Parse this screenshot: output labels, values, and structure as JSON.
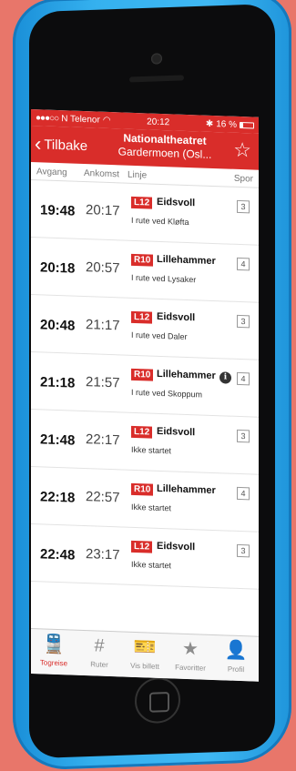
{
  "status": {
    "carrier": "N Telenor",
    "time": "20:12",
    "battery": "16 %"
  },
  "nav": {
    "back_label": "Tilbake",
    "title_line1": "Nationaltheatret",
    "title_line2": "Gardermoen (Osl..."
  },
  "columns": {
    "departure": "Avgang",
    "arrival": "Ankomst",
    "line": "Linje",
    "track": "Spor"
  },
  "rows": [
    {
      "dep": "19:48",
      "arr": "20:17",
      "line": "L12",
      "dest": "Eidsvoll",
      "note": "I rute ved Kløfta",
      "track": "3"
    },
    {
      "dep": "20:18",
      "arr": "20:57",
      "line": "R10",
      "dest": "Lillehammer",
      "note": "I rute ved Lysaker",
      "track": "4"
    },
    {
      "dep": "20:48",
      "arr": "21:17",
      "line": "L12",
      "dest": "Eidsvoll",
      "note": "I rute ved Daler",
      "track": "3"
    },
    {
      "dep": "21:18",
      "arr": "21:57",
      "line": "R10",
      "dest": "Lillehammer",
      "note": "I rute ved Skoppum",
      "track": "4",
      "info": "i"
    },
    {
      "dep": "21:48",
      "arr": "22:17",
      "line": "L12",
      "dest": "Eidsvoll",
      "note": "Ikke startet",
      "track": "3"
    },
    {
      "dep": "22:18",
      "arr": "22:57",
      "line": "R10",
      "dest": "Lillehammer",
      "note": "Ikke startet",
      "track": "4"
    },
    {
      "dep": "22:48",
      "arr": "23:17",
      "line": "L12",
      "dest": "Eidsvoll",
      "note": "Ikke startet",
      "track": "3"
    }
  ],
  "tabs": [
    {
      "label": "Togreise",
      "icon": "train-icon",
      "glyph": "🚆"
    },
    {
      "label": "Ruter",
      "icon": "hash-icon",
      "glyph": "#"
    },
    {
      "label": "Vis billett",
      "icon": "ticket-icon",
      "glyph": "🎫"
    },
    {
      "label": "Favoritter",
      "icon": "star-icon",
      "glyph": "★"
    },
    {
      "label": "Profil",
      "icon": "profile-icon",
      "glyph": "👤"
    }
  ],
  "colors": {
    "brand_red": "#d92d2a",
    "phone_blue": "#35b1ef",
    "background": "#e8766a"
  }
}
